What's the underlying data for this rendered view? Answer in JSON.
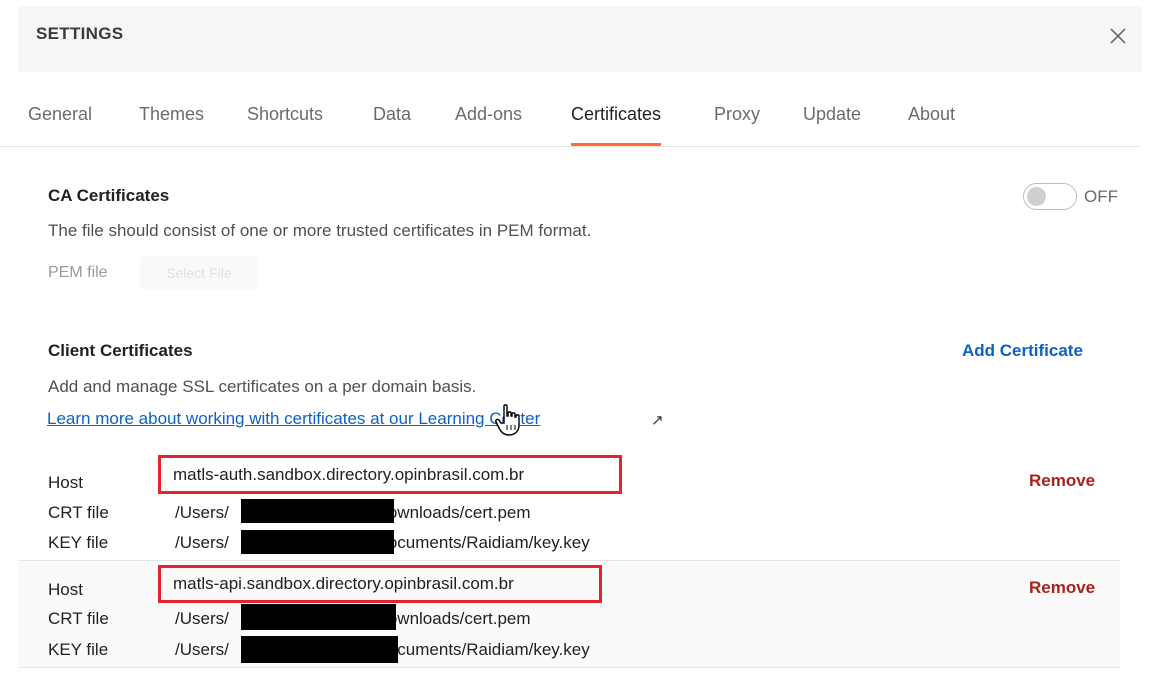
{
  "header": {
    "title": "SETTINGS"
  },
  "tabs": [
    {
      "label": "General"
    },
    {
      "label": "Themes"
    },
    {
      "label": "Shortcuts"
    },
    {
      "label": "Data"
    },
    {
      "label": "Add-ons"
    },
    {
      "label": "Certificates",
      "active": true
    },
    {
      "label": "Proxy"
    },
    {
      "label": "Update"
    },
    {
      "label": "About"
    }
  ],
  "ca": {
    "title": "CA Certificates",
    "description": "The file should consist of one or more trusted certificates in PEM format.",
    "toggle_label": "OFF",
    "toggle_on": false,
    "pem_label": "PEM file",
    "select_file": "Select File"
  },
  "client": {
    "title": "Client Certificates",
    "add_label": "Add Certificate",
    "description": "Add and manage SSL certificates on a per domain basis.",
    "learn_link": "Learn more about working with certificates at our Learning Center"
  },
  "labels": {
    "host": "Host",
    "crt": "CRT file",
    "key": "KEY file",
    "remove": "Remove"
  },
  "certificates": [
    {
      "host": "matls-auth.sandbox.directory.opinbrasil.com.br",
      "crt_prefix": "/Users/",
      "crt_suffix": "/Downloads/cert.pem",
      "key_prefix": "/Users/",
      "key_suffix": "/Documents/Raidiam/key.key"
    },
    {
      "host": "matls-api.sandbox.directory.opinbrasil.com.br",
      "crt_prefix": "/Users/",
      "crt_suffix": "/Downloads/cert.pem",
      "key_prefix": "/Users/",
      "key_suffix": "/Documents/Raidiam/key.key"
    }
  ],
  "colors": {
    "accent": "#ff6c37",
    "link": "#0b62c4",
    "danger": "#a7221c",
    "highlight": "#e4242c"
  }
}
